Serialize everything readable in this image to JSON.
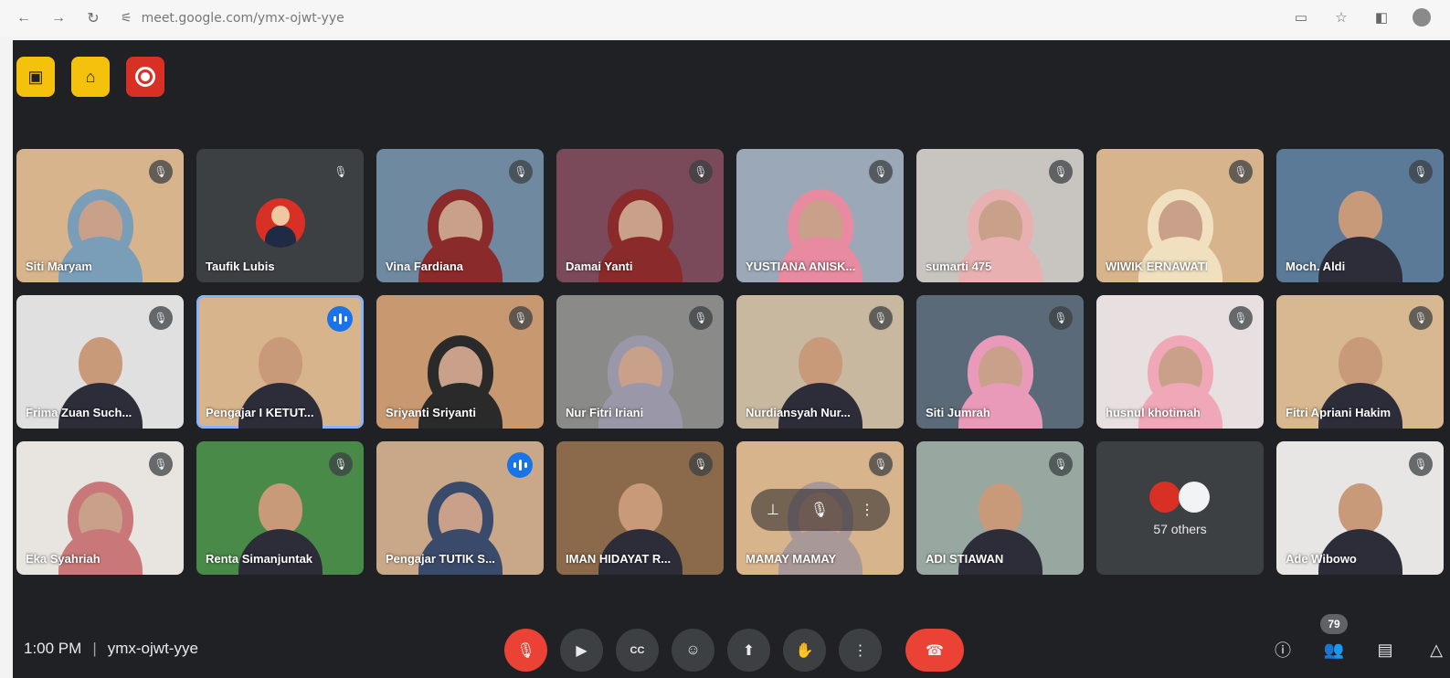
{
  "browser": {
    "url": "meet.google.com/ymx-ojwt-yye",
    "back": "←",
    "forward": "→",
    "reload": "↻",
    "tune": "⚟"
  },
  "top_icons": [
    {
      "name": "camera-off-icon",
      "glyph": "▣"
    },
    {
      "name": "door-icon",
      "glyph": "⌂"
    }
  ],
  "participants": [
    {
      "name": "Siti Maryam",
      "bg": "#d8b48c",
      "hijab": "#7a9db8",
      "muted": true
    },
    {
      "name": "Taufik Lubis",
      "bg": "#3c4043",
      "avatar": true,
      "muted": true
    },
    {
      "name": "Vina Fardiana",
      "bg": "#6f8aa0",
      "hijab": "#8a2a2a",
      "muted": true
    },
    {
      "name": "Damai Yanti",
      "bg": "#7a4a5a",
      "hijab": "#8a2a2a",
      "muted": true
    },
    {
      "name": "YUSTIANA ANISK...",
      "bg": "#9aa8b8",
      "hijab": "#e88aa0",
      "muted": true
    },
    {
      "name": "sumarti 475",
      "bg": "#c8c4c0",
      "hijab": "#e8b0b0",
      "muted": true
    },
    {
      "name": "WIWIK ERNAWATI",
      "bg": "#d8b48c",
      "hijab": "#f0e0c0",
      "muted": true
    },
    {
      "name": "Moch. Aldi",
      "bg": "#5a7a98",
      "muted": true
    },
    {
      "name": "Frima Zuan Such...",
      "bg": "#e0e0e0",
      "muted": true
    },
    {
      "name": "Pengajar I KETUT...",
      "bg": "#d8b48c",
      "speaking": true,
      "active": true
    },
    {
      "name": "Sriyanti Sriyanti",
      "bg": "#c89870",
      "hijab": "#2a2a2a",
      "muted": true
    },
    {
      "name": "Nur Fitri Iriani",
      "bg": "#8a8a88",
      "hijab": "#9a98a8",
      "muted": true
    },
    {
      "name": "Nurdiansyah Nur...",
      "bg": "#c8b8a0",
      "muted": true
    },
    {
      "name": "Siti Jumrah",
      "bg": "#5a6a78",
      "hijab": "#e89ab8",
      "muted": true
    },
    {
      "name": "husnul khotimah",
      "bg": "#e8e0e0",
      "hijab": "#f0a8b8",
      "muted": true
    },
    {
      "name": "Fitri Apriani Hakim",
      "bg": "#d8b890",
      "muted": true
    },
    {
      "name": "Eka Syahriah",
      "bg": "#e8e4e0",
      "hijab": "#c87878",
      "muted": true
    },
    {
      "name": "Renta Simanjuntak",
      "bg": "#4a8a48",
      "muted": true
    },
    {
      "name": "Pengajar TUTIK S...",
      "bg": "#c8a888",
      "hijab": "#3a4a6a",
      "speaking": true
    },
    {
      "name": "IMAN HIDAYAT R...",
      "bg": "#8a6a4a",
      "muted": true
    },
    {
      "name": "MAMAY MAMAY",
      "bg": "#d8b48c",
      "hijab": "#a89898",
      "muted": true,
      "hover": true
    },
    {
      "name": "ADI STIAWAN",
      "bg": "#98a8a0",
      "muted": true
    },
    {
      "name": "57 others",
      "others": true
    },
    {
      "name": "Ade Wibowo",
      "bg": "#e8e6e4",
      "muted": true
    }
  ],
  "meeting": {
    "time": "1:00 PM",
    "separator": "|",
    "code": "ymx-ojwt-yye"
  },
  "controls": {
    "mic": "🎙",
    "camera": "▶",
    "captions": "CC",
    "emoji": "☺",
    "present": "⬆",
    "hand": "✋",
    "more": "⋮",
    "hangup": "☎"
  },
  "right_controls": {
    "info": "ⓘ",
    "people": "👥",
    "people_count": "79",
    "chat": "▤",
    "activities": "△"
  },
  "hover": {
    "pin": "⊥",
    "mute": "🎙",
    "more": "⋮"
  }
}
